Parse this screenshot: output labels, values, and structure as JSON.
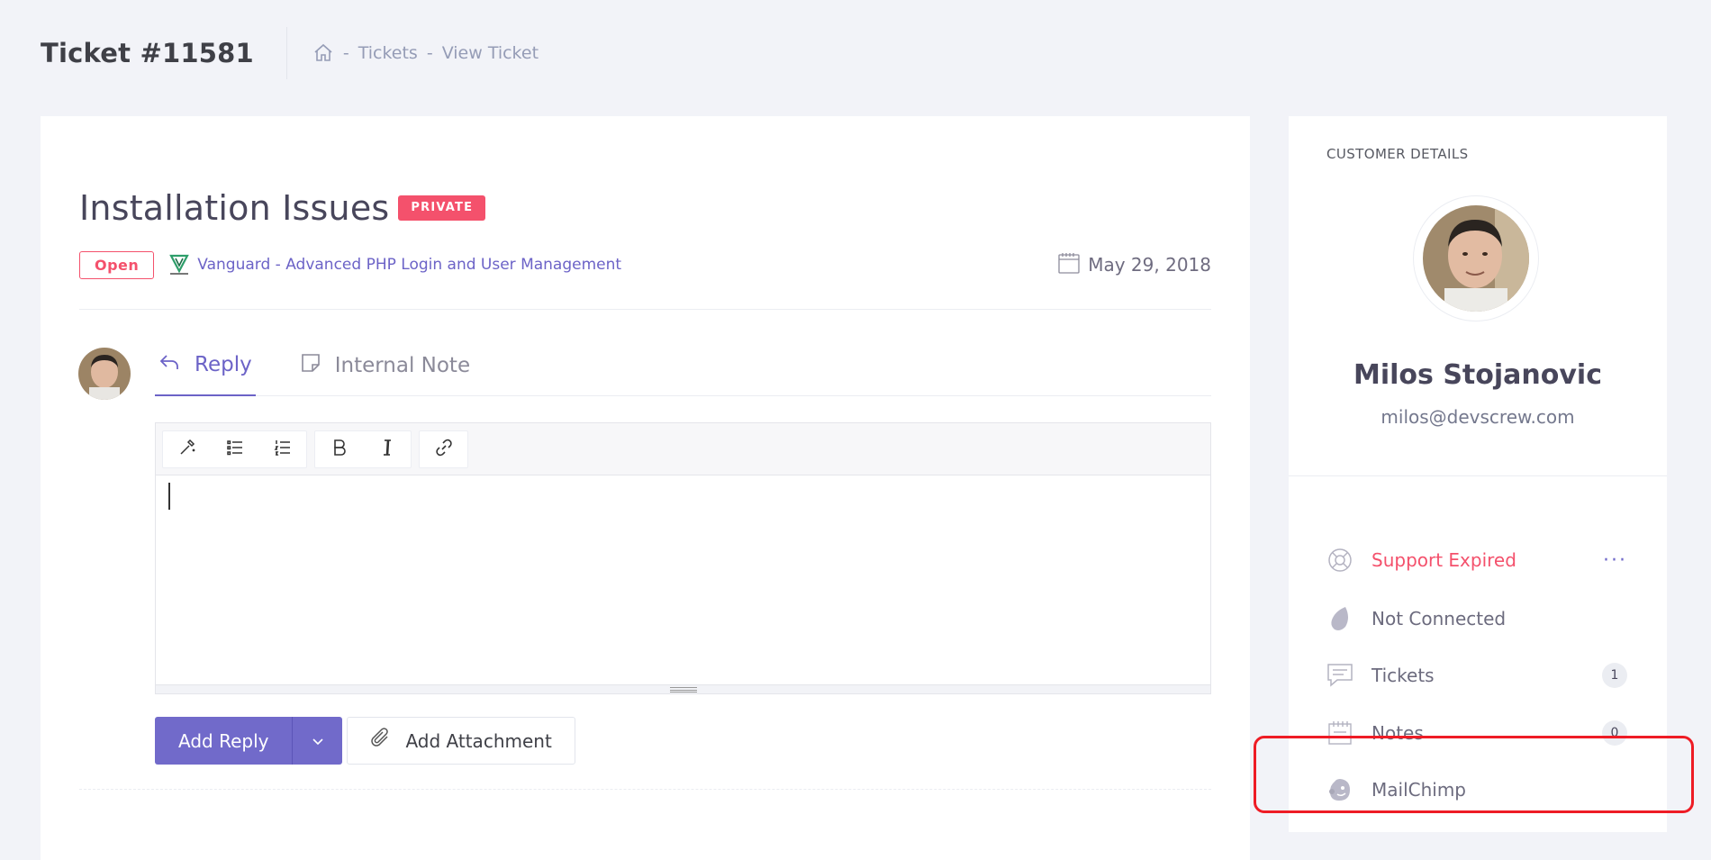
{
  "header": {
    "title": "Ticket #11581",
    "breadcrumb": [
      {
        "label": "Tickets"
      },
      {
        "label": "View Ticket"
      }
    ],
    "separator": "-"
  },
  "ticket": {
    "title": "Installation Issues",
    "private_badge": "PRIVATE",
    "status": "Open",
    "product": "Vanguard - Advanced PHP Login and User Management",
    "date": "May 29, 2018"
  },
  "tabs": [
    {
      "label": "Reply",
      "icon": "reply-icon",
      "active": true
    },
    {
      "label": "Internal Note",
      "icon": "note-icon",
      "active": false
    }
  ],
  "editor": {
    "toolbar_groups": [
      [
        "magic-wand-icon",
        "unordered-list-icon",
        "ordered-list-icon"
      ],
      [
        "bold-icon",
        "italic-icon"
      ],
      [
        "link-icon"
      ]
    ]
  },
  "actions": {
    "add_reply": "Add Reply",
    "add_attachment": "Add Attachment"
  },
  "customer": {
    "heading": "CUSTOMER DETAILS",
    "name": "Milos Stojanovic",
    "email": "milos@devscrew.com",
    "items": [
      {
        "label": "Support Expired",
        "icon": "lifebuoy-icon",
        "status": "danger",
        "more": "···"
      },
      {
        "label": "Not Connected",
        "icon": "envato-icon"
      },
      {
        "label": "Tickets",
        "icon": "chat-icon",
        "count": "1"
      },
      {
        "label": "Notes",
        "icon": "notepad-icon",
        "count": "0"
      },
      {
        "label": "MailChimp",
        "icon": "mailchimp-icon"
      }
    ]
  },
  "colors": {
    "accent": "#716aca",
    "danger": "#f4516c",
    "highlight": "#ee1c25"
  }
}
